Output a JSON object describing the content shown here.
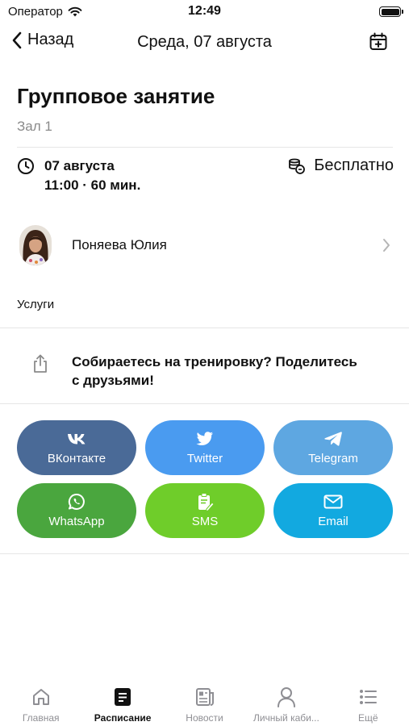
{
  "status_bar": {
    "carrier": "Оператор",
    "time": "12:49"
  },
  "nav": {
    "back_label": "Назад",
    "title": "Среда, 07 августа"
  },
  "event": {
    "title": "Групповое занятие",
    "hall": "Зал 1",
    "date": "07 августа",
    "time_duration": "11:00 · 60 мин.",
    "price": "Бесплатно"
  },
  "trainer": {
    "name": "Поняева Юлия"
  },
  "services": {
    "label": "Услуги"
  },
  "share": {
    "prompt_line1": "Собираетесь на тренировку? Поделитесь",
    "prompt_line2": "с друзьями!",
    "buttons": [
      {
        "label": "ВКонтакте",
        "icon": "vk-icon",
        "color": "#4a6a97"
      },
      {
        "label": "Twitter",
        "icon": "twitter-icon",
        "color": "#4a9bf0"
      },
      {
        "label": "Telegram",
        "icon": "telegram-icon",
        "color": "#5ea7e1"
      },
      {
        "label": "WhatsApp",
        "icon": "whatsapp-icon",
        "color": "#4aa63e"
      },
      {
        "label": "SMS",
        "icon": "sms-icon",
        "color": "#6fcd2a"
      },
      {
        "label": "Email",
        "icon": "email-icon",
        "color": "#12a9e0"
      }
    ]
  },
  "tab_bar": {
    "active": "Расписание",
    "items": [
      {
        "label": "Главная",
        "icon": "home-icon"
      },
      {
        "label": "Расписание",
        "icon": "schedule-icon"
      },
      {
        "label": "Новости",
        "icon": "news-icon"
      },
      {
        "label": "Личный каби...",
        "icon": "profile-icon"
      },
      {
        "label": "Ещё",
        "icon": "more-icon"
      }
    ]
  }
}
